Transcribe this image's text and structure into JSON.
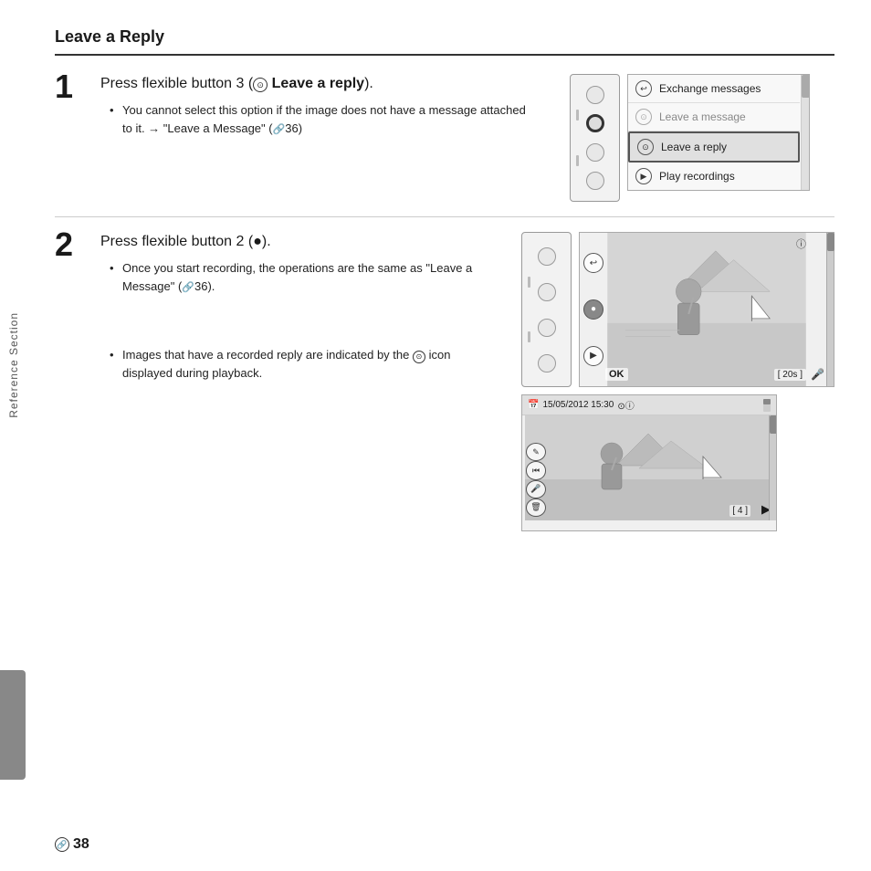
{
  "page": {
    "title": "Leave a Reply",
    "footer": "638"
  },
  "sidebar": {
    "label": "Reference Section"
  },
  "step1": {
    "number": "1",
    "heading": "Press flexible button 3 (",
    "heading_bold": "Leave a reply",
    "heading_end": ").",
    "bullet1": "You cannot select this option if the image does not have a message attached to it. → \"Leave a Message\" (",
    "bullet1_ref": "0●36",
    "bullet1_end": ")"
  },
  "step2": {
    "number": "2",
    "heading": "Press flexible button 2 (",
    "heading_symbol": "●",
    "heading_end": ").",
    "bullet1": "Once you start recording, the operations are the same as \"Leave a Message\" (",
    "bullet1_ref": "0●36",
    "bullet1_end": ").",
    "bullet2": "Images that have a recorded reply are indicated by the",
    "bullet2_icon": "⊙",
    "bullet2_end": "icon displayed during playback."
  },
  "menu": {
    "items": [
      {
        "icon": "↩",
        "label": "Exchange messages",
        "highlighted": false
      },
      {
        "icon": "⊙",
        "label": "Leave a message",
        "highlighted": false
      },
      {
        "icon": "⊙",
        "label": "Leave a reply",
        "highlighted": true
      },
      {
        "icon": "▶",
        "label": "Play recordings",
        "highlighted": false
      }
    ]
  },
  "playback": {
    "timestamp": "15/05/2012  15:30",
    "timer1": "[ 20s ]",
    "timer2": "[ 4 ]"
  }
}
